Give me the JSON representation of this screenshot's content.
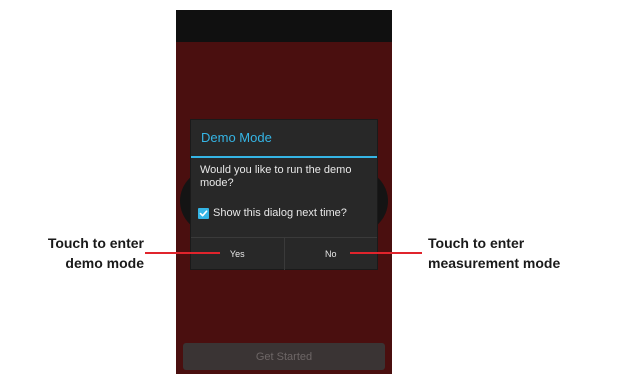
{
  "dialog": {
    "title": "Demo Mode",
    "message": "Would you like to run the demo mode?",
    "checkbox_label": "Show this dialog next time?",
    "checkbox_checked": true,
    "yes_label": "Yes",
    "no_label": "No"
  },
  "app": {
    "get_started_label": "Get Started"
  },
  "annotations": {
    "left_line1": "Touch to enter",
    "left_line2": "demo mode",
    "right_line1": "Touch to enter",
    "right_line2": "measurement mode"
  },
  "colors": {
    "accent": "#35b5e5",
    "callout_line": "#e0242c",
    "app_background": "#4a0f0f"
  }
}
